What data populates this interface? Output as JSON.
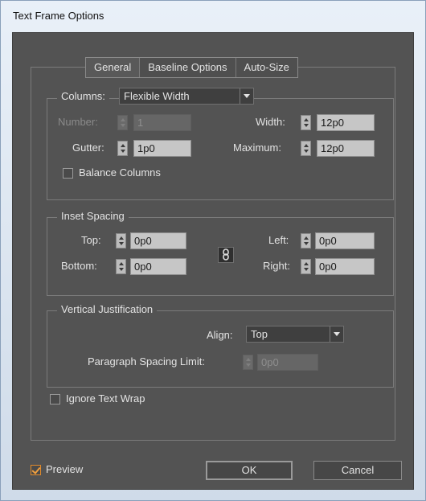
{
  "window": {
    "title": "Text Frame Options"
  },
  "tabs": [
    {
      "label": "General",
      "active": true
    },
    {
      "label": "Baseline Options",
      "active": false
    },
    {
      "label": "Auto-Size",
      "active": false
    }
  ],
  "columns": {
    "legend_label": "Columns:",
    "type_value": "Flexible Width",
    "number": {
      "label": "Number:",
      "value": "1",
      "enabled": false
    },
    "width": {
      "label": "Width:",
      "value": "12p0"
    },
    "gutter": {
      "label": "Gutter:",
      "value": "1p0"
    },
    "maximum": {
      "label": "Maximum:",
      "value": "12p0"
    },
    "balance": {
      "label": "Balance Columns",
      "checked": false
    }
  },
  "inset": {
    "legend": "Inset Spacing",
    "top": {
      "label": "Top:",
      "value": "0p0"
    },
    "bottom": {
      "label": "Bottom:",
      "value": "0p0"
    },
    "left": {
      "label": "Left:",
      "value": "0p0"
    },
    "right": {
      "label": "Right:",
      "value": "0p0"
    }
  },
  "vertical": {
    "legend": "Vertical Justification",
    "align": {
      "label": "Align:",
      "value": "Top"
    },
    "paragraph_spacing": {
      "label": "Paragraph Spacing Limit:",
      "value": "0p0",
      "enabled": false
    }
  },
  "ignore_wrap": {
    "label": "Ignore Text Wrap",
    "checked": false
  },
  "preview": {
    "label": "Preview",
    "checked": true
  },
  "buttons": {
    "ok": "OK",
    "cancel": "Cancel"
  },
  "colors": {
    "panel": "#535353",
    "accent": "#e08a2b",
    "field": "#c6c6c6"
  }
}
